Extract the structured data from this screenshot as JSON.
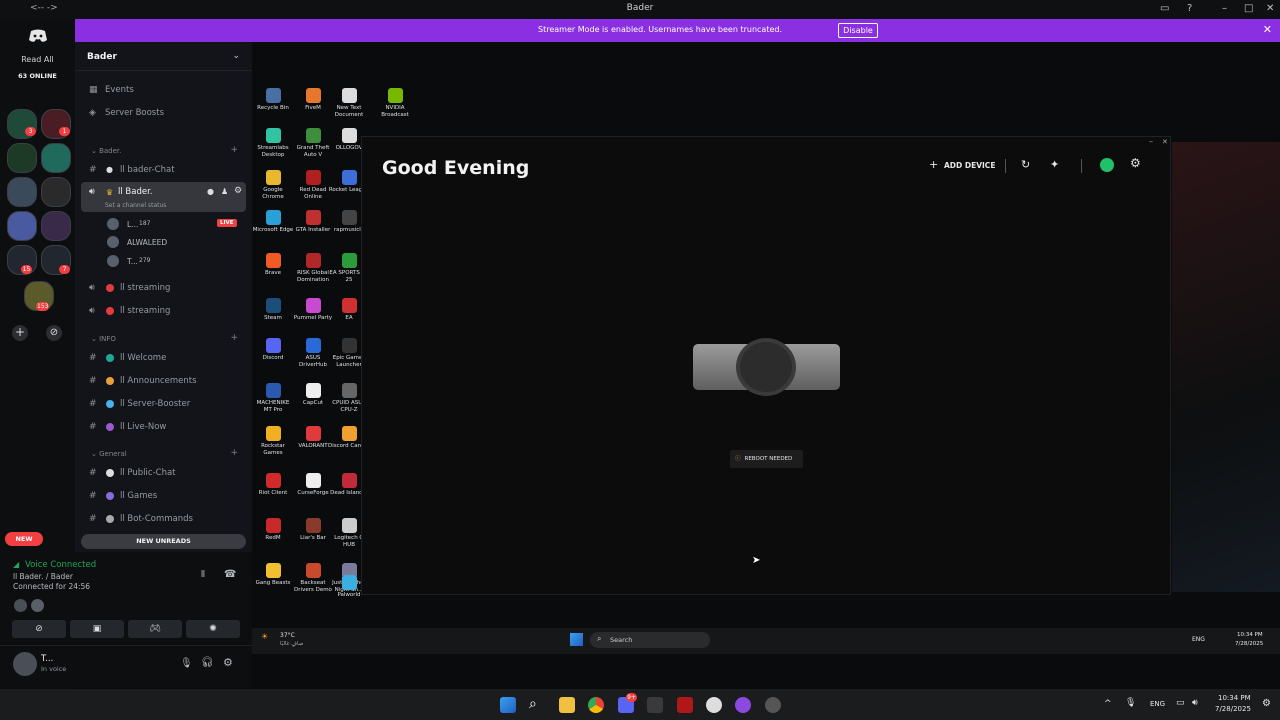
{
  "window": {
    "title": "Bader",
    "nav": "<-- ->"
  },
  "banner": {
    "text": "Streamer Mode is enabled. Usernames have been truncated.",
    "button": "Disable"
  },
  "rail": {
    "read_all": "Read All",
    "online": "63 ONLINE",
    "badges": [
      "3",
      "1",
      "15",
      "7",
      "153"
    ],
    "new_label": "NEW"
  },
  "sidebar": {
    "server_name": "Bader",
    "top_items": [
      {
        "icon": "events-icon",
        "label": "Events"
      },
      {
        "icon": "boost-icon",
        "label": "Server Boosts"
      }
    ],
    "cat_bader": "Bader.",
    "bader_chat": "ll bader-Chat",
    "voice_selected": "ll Bader.",
    "channel_status": "Set a channel status",
    "voice_users": [
      {
        "name": "L...",
        "count": "187",
        "live": "LIVE"
      },
      {
        "name": "ALWALEED",
        "count": "",
        "live": ""
      },
      {
        "name": "T...",
        "count": "279",
        "live": ""
      }
    ],
    "streaming": [
      "ll streaming",
      "ll streaming"
    ],
    "cat_info": "INFO",
    "info_channels": [
      "ll Welcome",
      "ll Announcements",
      "ll Server-Booster",
      "ll Live-Now"
    ],
    "cat_general": "General",
    "general_channels": [
      "ll Public-Chat",
      "ll Games",
      "ll Bot-Commands"
    ],
    "new_unreads": "NEW UNREADS"
  },
  "voice": {
    "status": "Voice Connected",
    "channel": "ll Bader. / Bader",
    "connected_for": "Connected for 24:56",
    "user_name": "T...",
    "user_status": "In voice"
  },
  "stream": {
    "desktop_icons": [
      {
        "label": "Recycle Bin",
        "color": "#4a6fa5"
      },
      {
        "label": "FiveM",
        "color": "#e8772e"
      },
      {
        "label": "New Text Document",
        "color": "#dcdcdc"
      },
      {
        "label": "NVIDIA Broadcast",
        "color": "#76b900"
      },
      {
        "label": "Streamlabs Desktop",
        "color": "#31c3a2"
      },
      {
        "label": "Grand Theft Auto V",
        "color": "#3e8e3e"
      },
      {
        "label": "OLLOGOV",
        "color": "#dddddd"
      },
      {
        "label": "Google Chrome",
        "color": "#e8b92e"
      },
      {
        "label": "Red Dead Online",
        "color": "#b02020"
      },
      {
        "label": "Rocket League",
        "color": "#3b6ed8"
      },
      {
        "label": "Microsoft Edge",
        "color": "#2aa0d8"
      },
      {
        "label": "GTA Installer",
        "color": "#c03030"
      },
      {
        "label": "rapmusicly",
        "color": "#444444"
      },
      {
        "label": "EA SPORTS FC 25",
        "color": "#2a9d3a"
      },
      {
        "label": "Brave",
        "color": "#f05a24"
      },
      {
        "label": "RISK Global Domination",
        "color": "#b02828"
      },
      {
        "label": "EA",
        "color": "#d03030"
      },
      {
        "label": "Steam",
        "color": "#1b4f7a"
      },
      {
        "label": "Pummel Party",
        "color": "#c84ad0"
      },
      {
        "label": "Epic Games Launcher",
        "color": "#333333"
      },
      {
        "label": "Discord",
        "color": "#5865f2"
      },
      {
        "label": "ASUS DriverHub",
        "color": "#2a6ad8"
      },
      {
        "label": "CPUID ASUS CPU-Z",
        "color": "#666666"
      },
      {
        "label": "MACHENIKE MT Pro",
        "color": "#2a5ab0"
      },
      {
        "label": "CapCut",
        "color": "#eeeeee"
      },
      {
        "label": "Discord Canary",
        "color": "#f0a030"
      },
      {
        "label": "Rockstar Games",
        "color": "#f0b020"
      },
      {
        "label": "VALORANT",
        "color": "#e03a3a"
      },
      {
        "label": "Dead Island 2",
        "color": "#c02a3a"
      },
      {
        "label": "Riot Client",
        "color": "#d02a2a"
      },
      {
        "label": "CurseForge",
        "color": "#eeeeee"
      },
      {
        "label": "Logitech G HUB",
        "color": "#cccccc"
      },
      {
        "label": "RedM",
        "color": "#c82a2a"
      },
      {
        "label": "Liar's Bar",
        "color": "#8a3a2a"
      },
      {
        "label": "Just Another Night Sh...",
        "color": "#7a7a9a"
      },
      {
        "label": "Gang Beasts",
        "color": "#f0c030"
      },
      {
        "label": "Backseat Drivers Demo",
        "color": "#c84a2a"
      },
      {
        "label": "Palworld",
        "color": "#3ab0e0"
      }
    ],
    "logi": {
      "greeting": "Good Evening",
      "add_device": "ADD DEVICE",
      "reboot": "REBOOT NEEDED"
    },
    "inner_taskbar": {
      "weather": "37°C",
      "weather_sub": "صافٍ غالبًا",
      "search": "Search",
      "lang": "ENG",
      "time": "10:34 PM",
      "date": "7/28/2025"
    }
  },
  "taskbar": {
    "lang": "ENG",
    "time": "10:34 PM",
    "date": "7/28/2025",
    "discord_badge": "9+"
  }
}
